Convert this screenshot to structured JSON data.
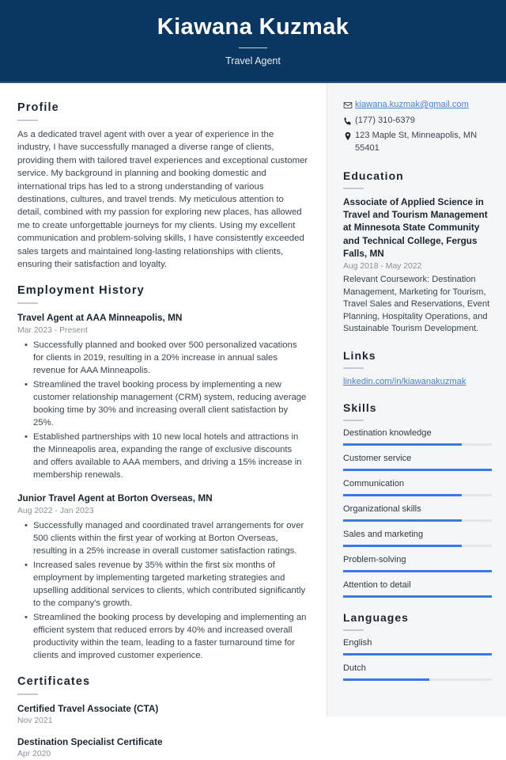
{
  "header": {
    "name": "Kiawana Kuzmak",
    "job_title": "Travel Agent",
    "background_color": "#0a3761"
  },
  "main": {
    "profile": {
      "heading": "Profile",
      "text": "As a dedicated travel agent with over a year of experience in the industry, I have successfully managed a diverse range of clients, providing them with tailored travel experiences and exceptional customer service. My background in planning and booking domestic and international trips has led to a strong understanding of various destinations, cultures, and travel trends. My meticulous attention to detail, combined with my passion for exploring new places, has allowed me to create unforgettable journeys for my clients. Using my excellent communication and problem-solving skills, I have consistently exceeded sales targets and maintained long-lasting relationships with clients, ensuring their satisfaction and loyalty."
    },
    "employment": {
      "heading": "Employment History",
      "jobs": [
        {
          "title": "Travel Agent at AAA Minneapolis, MN",
          "date": "Mar 2023 - Present",
          "bullets": [
            "Successfully planned and booked over 500 personalized vacations for clients in 2019, resulting in a 20% increase in annual sales revenue for AAA Minneapolis.",
            "Streamlined the travel booking process by implementing a new customer relationship management (CRM) system, reducing average booking time by 30% and increasing overall client satisfaction by 25%.",
            "Established partnerships with 10 new local hotels and attractions in the Minneapolis area, expanding the range of exclusive discounts and offers available to AAA members, and driving a 15% increase in membership renewals."
          ]
        },
        {
          "title": "Junior Travel Agent at Borton Overseas, MN",
          "date": "Aug 2022 - Jan 2023",
          "bullets": [
            "Successfully managed and coordinated travel arrangements for over 500 clients within the first year of working at Borton Overseas, resulting in a 25% increase in overall customer satisfaction ratings.",
            "Increased sales revenue by 35% within the first six months of employment by implementing targeted marketing strategies and upselling additional services to clients, which contributed significantly to the company's growth.",
            "Streamlined the booking process by developing and implementing an efficient system that reduced errors by 40% and increased overall productivity within the team, leading to a faster turnaround time for clients and improved customer experience."
          ]
        }
      ]
    },
    "certificates": {
      "heading": "Certificates",
      "items": [
        {
          "title": "Certified Travel Associate (CTA)",
          "date": "Nov 2021"
        },
        {
          "title": "Destination Specialist Certificate",
          "date": "Apr 2020"
        }
      ]
    }
  },
  "sidebar": {
    "contact": {
      "email": "kiawana.kuzmak@gmail.com",
      "phone": "(177) 310-6379",
      "address": "123 Maple St, Minneapolis, MN 55401",
      "email_icon": "envelope-icon",
      "phone_icon": "phone-icon",
      "address_icon": "map-pin-icon"
    },
    "education": {
      "heading": "Education",
      "degree": "Associate of Applied Science in Travel and Tourism Management at Minnesota State Community and Technical College, Fergus Falls, MN",
      "date": "Aug 2018 - May 2022",
      "description": "Relevant Coursework: Destination Management, Marketing for Tourism, Travel Sales and Reservations, Event Planning, Hospitality Operations, and Sustainable Tourism Development."
    },
    "links": {
      "heading": "Links",
      "items": [
        {
          "label": "linkedin.com/in/kiawanakuzmak"
        }
      ]
    },
    "skills": {
      "heading": "Skills",
      "accent_color": "#3b79e8",
      "items": [
        {
          "label": "Destination knowledge",
          "level": 80
        },
        {
          "label": "Customer service",
          "level": 100
        },
        {
          "label": "Communication",
          "level": 80
        },
        {
          "label": "Organizational skills",
          "level": 80
        },
        {
          "label": "Sales and marketing",
          "level": 80
        },
        {
          "label": "Problem-solving",
          "level": 100
        },
        {
          "label": "Attention to detail",
          "level": 100
        }
      ]
    },
    "languages": {
      "heading": "Languages",
      "items": [
        {
          "label": "English",
          "level": 100
        },
        {
          "label": "Dutch",
          "level": 58
        }
      ]
    }
  }
}
